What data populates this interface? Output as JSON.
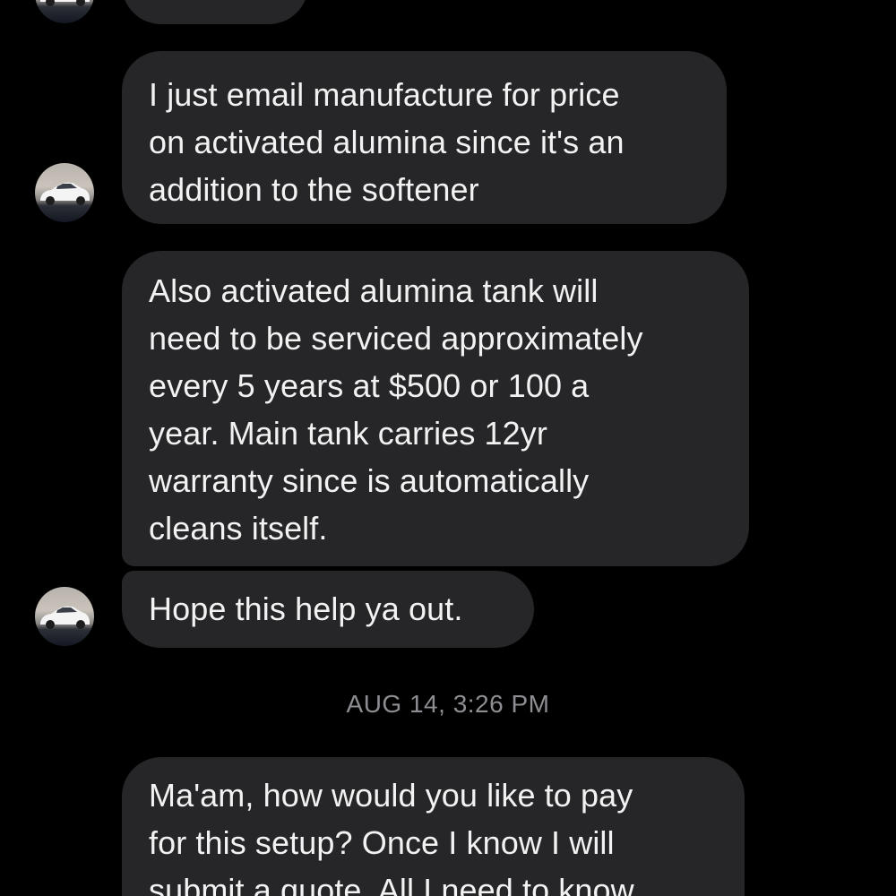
{
  "messages": [
    {
      "text": "",
      "avatar": "car-avatar"
    },
    {
      "text": "I just email manufacture for price\non activated alumina since it's an\naddition to the softener",
      "avatar": "car-avatar"
    },
    {
      "text": "Also activated alumina tank will\nneed to be serviced approximately\nevery 5 years at $500 or 100 a\nyear. Main tank carries 12yr\nwarranty since is automatically\ncleans itself."
    },
    {
      "text": "Hope this help ya out.",
      "avatar": "car-avatar"
    }
  ],
  "timestamp": "AUG 14, 3:26 PM",
  "messages_after": [
    {
      "text": "Ma'am,  how would you like to pay\nfor this setup? Once I know I will\nsubmit a quote. All I need to know"
    }
  ],
  "colors": {
    "background": "#000000",
    "bubble": "#262628",
    "text": "#f2f2f2",
    "timestamp": "#8d8d92"
  }
}
